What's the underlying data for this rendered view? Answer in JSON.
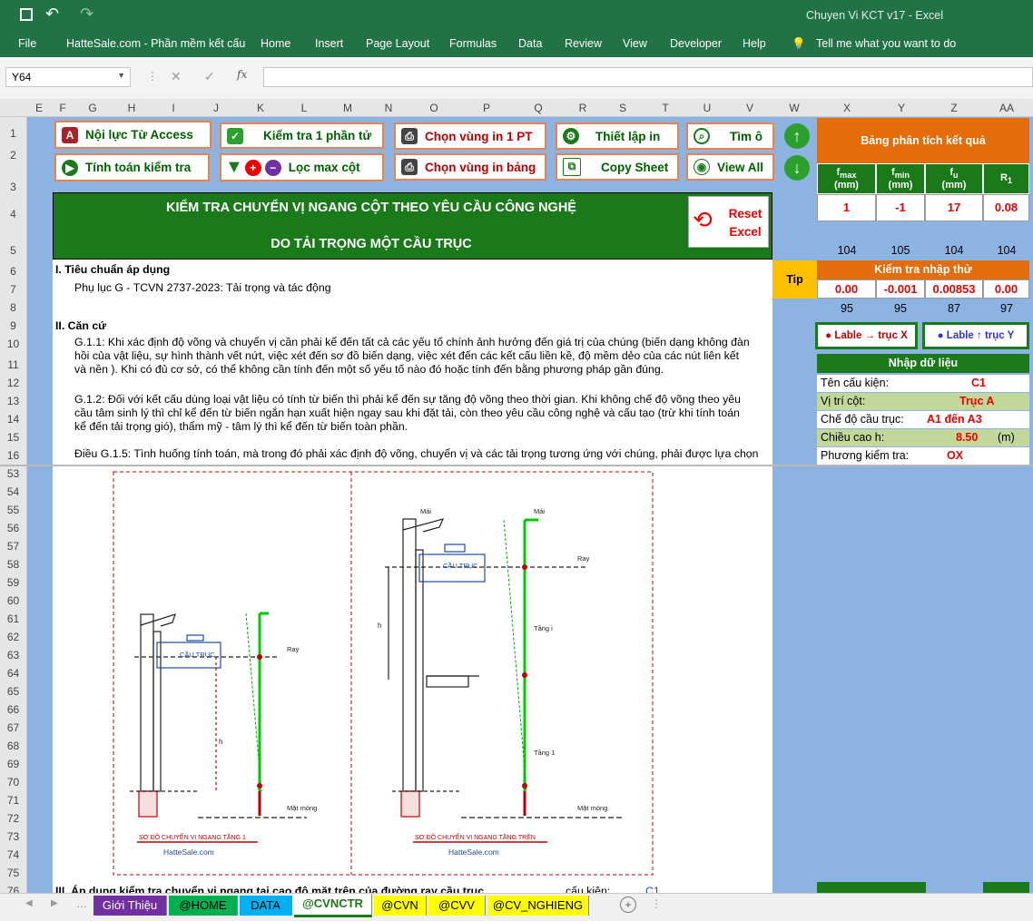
{
  "window": {
    "title": "Chuyen Vi KCT v17  -  Excel"
  },
  "ribbon": {
    "tabs": [
      "File",
      "HatteSale.com - Phần mềm kết cấu",
      "Home",
      "Insert",
      "Page Layout",
      "Formulas",
      "Data",
      "Review",
      "View",
      "Developer",
      "Help"
    ],
    "tell_me": "Tell me what you want to do"
  },
  "formula_bar": {
    "name_box": "Y64",
    "formula": ""
  },
  "columns": [
    "E",
    "F",
    "G",
    "H",
    "I",
    "J",
    "K",
    "L",
    "M",
    "N",
    "O",
    "P",
    "Q",
    "R",
    "S",
    "T",
    "U",
    "V",
    "W",
    "X",
    "Y",
    "Z",
    "AA"
  ],
  "rows_top": [
    "1",
    "2",
    "3",
    "4",
    "5",
    "6",
    "7",
    "8",
    "9",
    "10",
    "11",
    "12",
    "13",
    "14",
    "15",
    "16"
  ],
  "rows_bottom": [
    "53",
    "54",
    "55",
    "56",
    "57",
    "58",
    "59",
    "60",
    "61",
    "62",
    "63",
    "64",
    "65",
    "66",
    "67",
    "68",
    "69",
    "70",
    "71",
    "72",
    "73",
    "74",
    "75",
    "76"
  ],
  "buttons": {
    "noi_luc": "Nội lực Từ Access",
    "kiem_tra": "Kiểm tra 1 phần tử",
    "chon_vung_pt": "Chọn vùng in 1 PT",
    "thiet_lap": "Thiết lập in",
    "tim": "Tìm ô",
    "tinh_toan": "Tính toán kiểm tra",
    "loc_max": "Lọc max cột",
    "chon_vung_bang": "Chọn vùng in bảng",
    "copy_sheet": "Copy Sheet",
    "view_all": "View All",
    "reset": "Reset Excel",
    "lable_x": "Lable → trục X",
    "lable_y": "Lable ↑ trục Y",
    "tip": "Tip"
  },
  "title_block": {
    "line1": "KIỂM TRA CHUYỂN VỊ NGANG CỘT THEO YÊU CẦU CÔNG NGHỆ",
    "line2": "DO TẢI TRỌNG MỘT CẦU TRỤC"
  },
  "results": {
    "title": "Bảng phân tích kết quả",
    "headers": [
      "fmax (mm)",
      "fmin (mm)",
      "fu (mm)",
      "R1"
    ],
    "values": [
      "1",
      "-1",
      "17",
      "0.08"
    ],
    "row5": [
      "104",
      "105",
      "104",
      "104"
    ],
    "check_title": "Kiểm tra nhập thử",
    "check_values": [
      "0.00",
      "-0.001",
      "0.00853",
      "0.00"
    ],
    "row8": [
      "95",
      "95",
      "87",
      "97"
    ]
  },
  "input": {
    "title": "Nhập dữ liệu",
    "rows": [
      {
        "label": "Tên cấu kiện:",
        "value": "C1"
      },
      {
        "label": "Vị trí cột:",
        "value": "Trục A"
      },
      {
        "label": "Chế độ cầu trục:",
        "value": "A1 đến A3"
      },
      {
        "label": "Chiều cao h:",
        "value": "8.50",
        "unit": "(m)"
      },
      {
        "label": "Phương kiểm tra:",
        "value": "OX"
      }
    ]
  },
  "content": {
    "sec1": "I.  Tiêu chuẩn áp dụng",
    "sec1_text": "Phụ lục G - TCVN 2737-2023: Tải trọng và tác động",
    "sec2": "II.  Căn cứ",
    "g11_a": "G.1.1: Khi xác định độ võng và chuyển vị cần phải kể đến tất cả các yếu tố chính ảnh hưởng đến giá trị của chúng (biến dạng không đàn",
    "g11_b": "hồi của vật liệu, sự hình thành vết nứt, việc xét đến sơ đồ biến dạng, việc xét đến các kết cấu liền kề, độ mềm dẻo của các nút liên kết",
    "g11_c": "và nền ). Khi có đủ cơ sở, có thể không cần tính đến một số yếu tố nào đó hoặc tính đến bằng phương pháp gần đúng.",
    "g12_a": "G.1.2: Đối với kết cấu dùng loại vật liệu có tính từ biến thì phải kể đến sự tăng độ võng theo thời gian. Khi không chế độ võng theo yêu",
    "g12_b": "cầu tâm sinh lý thì chỉ kể đến từ biến ngắn hạn xuất hiện ngay sau khi đặt tải, còn theo yêu cầu công nghệ và cấu tạo (trừ khi tính toán",
    "g12_c": "kể đến tải trọng gió), thẩm mỹ - tâm lý thì kể đến từ biến toàn phần.",
    "g15_a": "Điều G.1.5: Tình huống tính toán, mà trong đó phải xác định độ võng, chuyển vị và các tải trọng tương ứng với chúng, phải được lựa chọn",
    "sec3": "III.  Áp dụng kiểm tra chuyển vị ngang tại cao độ mặt trên của đường ray cầu trục",
    "sec3_tail": "cấu kiện:",
    "sec3_val": "C1"
  },
  "diagram": {
    "left_caption": "SƠ ĐỒ CHUYỂN VỊ NGANG TẦNG 1",
    "right_caption": "SƠ ĐỒ CHUYỂN VỊ NGANG TẦNG TRÊN",
    "site": "HatteSale.com",
    "crane": "CẦU TRỤC",
    "rail": "Ray",
    "ground": "Mặt móng",
    "roof": "Mái",
    "floor_i": "Tầng i",
    "floor_1": "Tầng 1"
  },
  "sheet_tabs": [
    {
      "name": "Giới Thiệu",
      "color": "#7030a0",
      "text": "#ffffff"
    },
    {
      "name": "@HOME",
      "color": "#00b050",
      "text": "#000000"
    },
    {
      "name": "DATA",
      "color": "#00b0f0",
      "text": "#000000"
    },
    {
      "name": "@CVNCTR",
      "color": "#ffffff",
      "text": "#000000"
    },
    {
      "name": "@CVN",
      "color": "#ffff00",
      "text": "#000000"
    },
    {
      "name": "@CVV",
      "color": "#ffff00",
      "text": "#000000"
    },
    {
      "name": "@CV_NGHIENG",
      "color": "#ffff00",
      "text": "#000000"
    }
  ]
}
